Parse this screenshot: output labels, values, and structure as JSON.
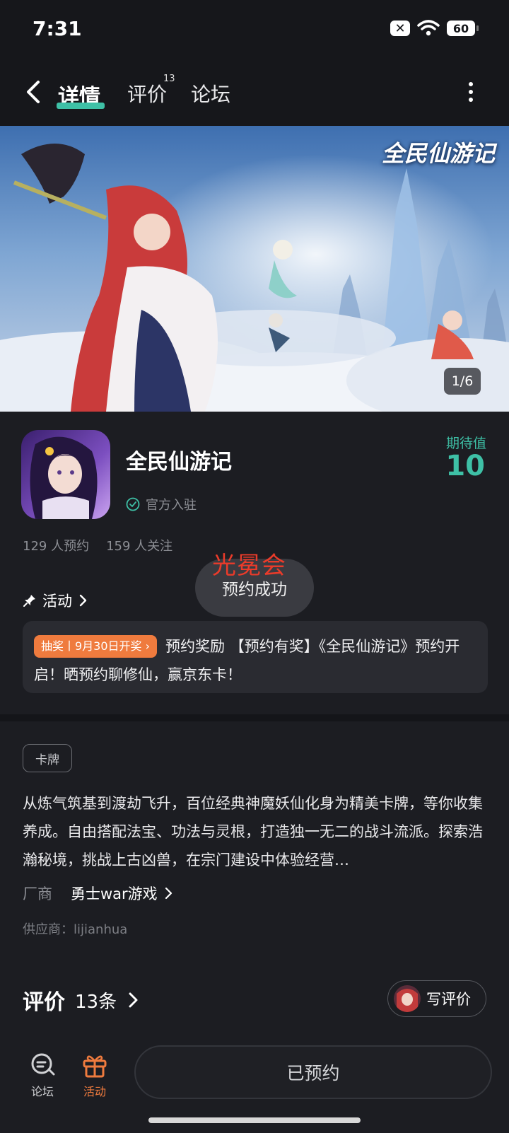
{
  "status_bar": {
    "time": "7:31",
    "battery": "60"
  },
  "nav": {
    "tabs": [
      {
        "label": "详情",
        "active": true
      },
      {
        "label": "评价",
        "sup": "13"
      },
      {
        "label": "论坛"
      }
    ]
  },
  "banner": {
    "game_logo_text": "全民仙游记",
    "counter": "1/6"
  },
  "app": {
    "name": "全民仙游记",
    "official_label": "官方入驻",
    "expectation_label": "期待值",
    "expectation_value": "10",
    "reservations": "129 人预约",
    "followers": "159 人关注"
  },
  "toast": {
    "text": "预约成功"
  },
  "watermark": {
    "text": "光冕会"
  },
  "activity": {
    "heading": "活动",
    "badge": "抽奖丨9月30日开奖",
    "text": "预约奖励 【预约有奖】《全民仙游记》预约开启！晒预约聊修仙，赢京东卡！"
  },
  "info": {
    "tag": "卡牌",
    "description": "从炼气筑基到渡劫飞升，百位经典神魔妖仙化身为精美卡牌，等你收集养成。自由搭配法宝、功法与灵根，打造独一无二的战斗流派。探索浩瀚秘境，挑战上古凶兽，在宗门建设中体验经营…",
    "manufacturer_label": "厂商",
    "manufacturer_value": "勇士war游戏",
    "supplier": "供应商：lijianhua"
  },
  "reviews": {
    "title": "评价",
    "count": "13条",
    "write_label": "写评价"
  },
  "bottom_bar": {
    "forum_label": "论坛",
    "activity_label": "活动",
    "reserved_label": "已预约"
  },
  "colors": {
    "accent": "#3ec0a6",
    "badge": "#ef7b3e",
    "background": "#1c1d22"
  }
}
